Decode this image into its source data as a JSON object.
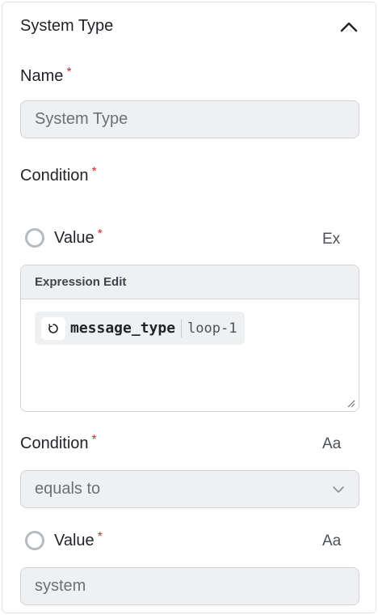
{
  "section": {
    "title": "System Type"
  },
  "name_field": {
    "label": "Name",
    "required_mark": "*",
    "value": "System Type"
  },
  "condition_group": {
    "label": "Condition",
    "required_mark": "*"
  },
  "left_operand": {
    "label": "Value",
    "required_mark": "*",
    "mode_label": "Ex",
    "editor": {
      "header": "Expression Edit",
      "chip": {
        "name": "message_type",
        "scope": "loop-1"
      }
    }
  },
  "operator": {
    "label": "Condition",
    "required_mark": "*",
    "mode_label": "Aa",
    "value": "equals to"
  },
  "right_operand": {
    "label": "Value",
    "required_mark": "*",
    "mode_label": "Aa",
    "value": "system"
  },
  "colors": {
    "required": "#d92c2c",
    "input_bg": "#eef0f2",
    "border": "#d0d4d9"
  }
}
